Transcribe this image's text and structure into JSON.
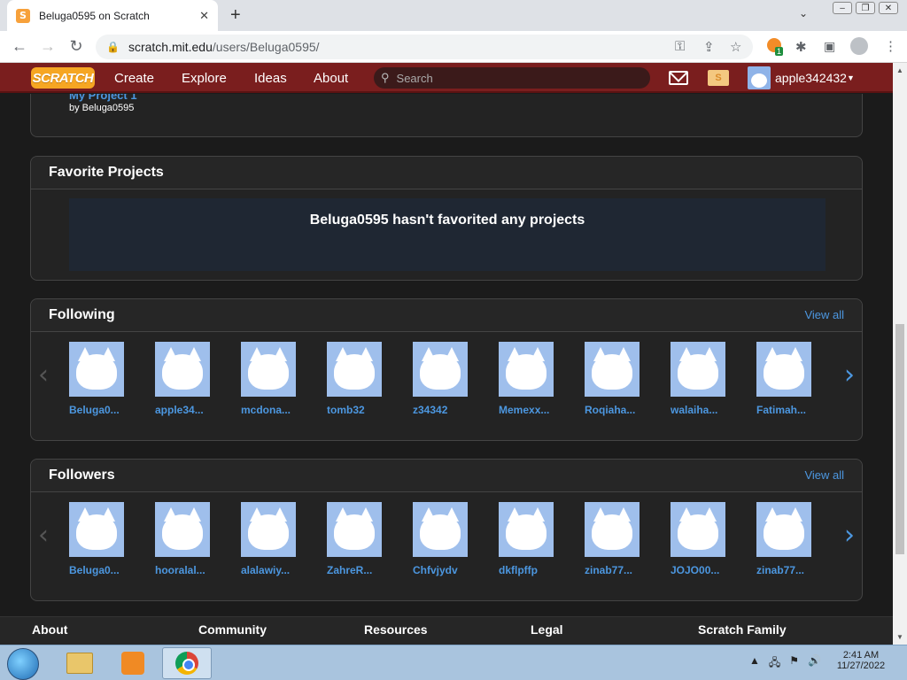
{
  "browser": {
    "tab_title": "Beluga0595 on Scratch",
    "favicon_letter": "S",
    "url_host": "scratch.mit.edu",
    "url_path": "/users/Beluga0595/",
    "extension_badge": "1"
  },
  "nav": {
    "logo": "SCRATCH",
    "links": [
      "Create",
      "Explore",
      "Ideas",
      "About"
    ],
    "search_placeholder": "Search",
    "username": "apple342432"
  },
  "project": {
    "title": "My Project 1",
    "by": "by Beluga0595"
  },
  "favorites": {
    "header": "Favorite Projects",
    "empty_message": "Beluga0595 hasn't favorited any projects"
  },
  "following": {
    "header": "Following",
    "view_all": "View all",
    "users": [
      "Beluga0...",
      "apple34...",
      "mcdona...",
      "tomb32",
      "z34342",
      "Memexx...",
      "Roqiaha...",
      "walaiha...",
      "Fatimah..."
    ]
  },
  "followers": {
    "header": "Followers",
    "view_all": "View all",
    "users": [
      "Beluga0...",
      "hooralal...",
      "alalawiy...",
      "ZahreR...",
      "Chfvjydv",
      "dkflpffp",
      "zinab77...",
      "JOJO00...",
      "zinab77..."
    ]
  },
  "footer": {
    "columns": [
      "About",
      "Community",
      "Resources",
      "Legal",
      "Scratch Family"
    ]
  },
  "taskbar": {
    "time": "2:41 AM",
    "date": "11/27/2022"
  }
}
